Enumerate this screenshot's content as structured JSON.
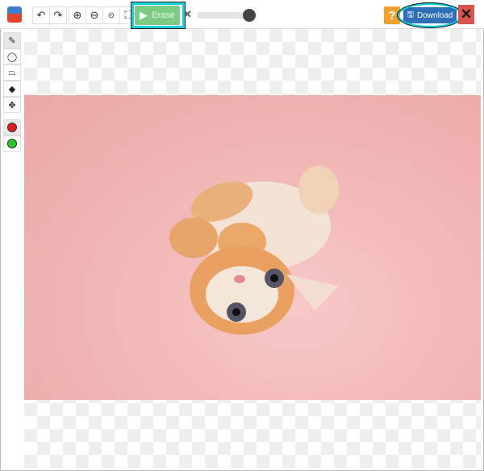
{
  "toolbar": {
    "undo_icon": "undo-icon",
    "redo_icon": "redo-icon",
    "zoom_in_icon": "zoom-in-icon",
    "zoom_out_icon": "zoom-out-icon",
    "zoom_reset_icon": "zoom-actual-icon",
    "zoom_fit_icon": "zoom-fit-icon",
    "erase_label": "Erase",
    "help_label": "?",
    "download_label": "Download",
    "close_label": "✕",
    "brush_size_percent": 90
  },
  "colors": {
    "erase": "#7ccb82",
    "download": "#2f6fb7",
    "help": "#f0a030",
    "close": "#d9534f",
    "highlight": "#14d0d8",
    "keep_marker": "#e21b1b",
    "remove_marker": "#22cc22"
  },
  "sidebar": {
    "tools": [
      "pencil",
      "lasso",
      "polygon",
      "eraser",
      "move"
    ],
    "markers": [
      "red",
      "green"
    ]
  }
}
